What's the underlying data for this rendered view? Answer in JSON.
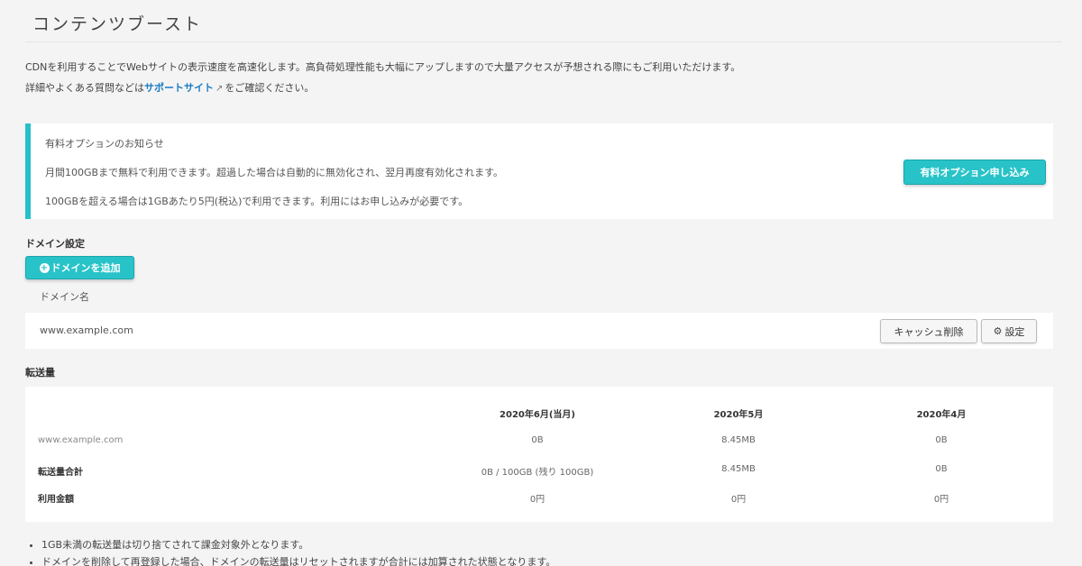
{
  "page": {
    "title": "コンテンツブースト",
    "description_line1": "CDNを利用することでWebサイトの表示速度を高速化します。高負荷処理性能も大幅にアップしますので大量アクセスが予想される際にもご利用いただけます。",
    "description_line2_prefix": "詳細やよくある質問などは",
    "support_link": "サポートサイト",
    "description_line2_suffix": "をご確認ください。"
  },
  "notice": {
    "title": "有料オプションのお知らせ",
    "line1": "月間100GBまで無料で利用できます。超過した場合は自動的に無効化され、翌月再度有効化されます。",
    "line2": "100GBを超える場合は1GBあたり5円(税込)で利用できます。利用にはお申し込みが必要です。",
    "button": "有料オプション申し込み"
  },
  "domain_settings": {
    "heading": "ドメイン設定",
    "add_button": "ドメインを追加",
    "column_label": "ドメイン名",
    "domain": "www.example.com",
    "cache_button": "キャッシュ削除",
    "settings_button": "設定"
  },
  "transfer": {
    "heading": "転送量",
    "columns": [
      "2020年6月(当月)",
      "2020年5月",
      "2020年4月"
    ],
    "rows": [
      {
        "label": "www.example.com",
        "values": [
          "0B",
          "8.45MB",
          "0B"
        ]
      },
      {
        "label": "転送量合計",
        "values": [
          "0B / 100GB (残り 100GB)",
          "8.45MB",
          "0B"
        ]
      },
      {
        "label": "利用金額",
        "values": [
          "0円",
          "0円",
          "0円"
        ]
      }
    ]
  },
  "notes": [
    "1GB未満の転送量は切り捨てされて課金対象外となります。",
    "ドメインを削除して再登録した場合、ドメインの転送量はリセットされますが合計には加算された状態となります。"
  ],
  "colors": {
    "accent": "#28c3c8",
    "link": "#1a7cc1",
    "background": "#f4f4f4"
  },
  "icons": {
    "external_link": "external-link-icon",
    "add": "plus-circle-icon",
    "settings": "gear-icon"
  }
}
